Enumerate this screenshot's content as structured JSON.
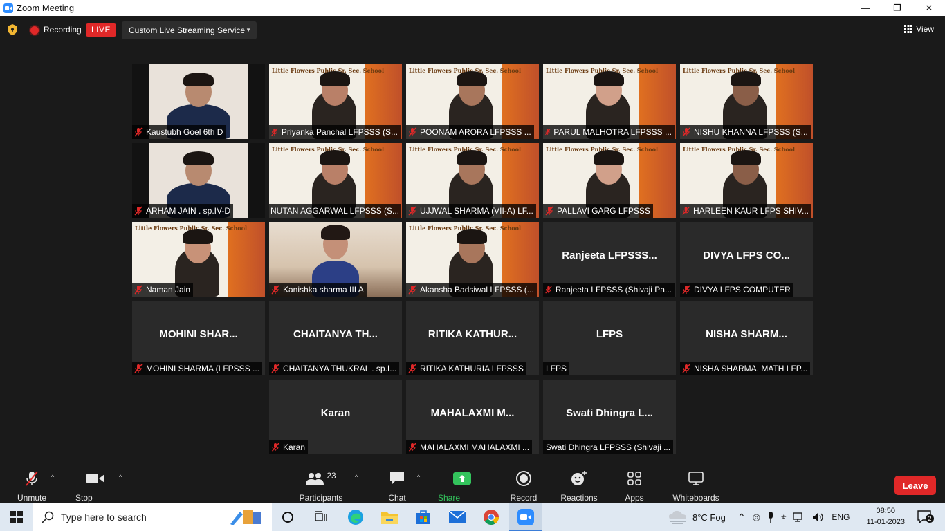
{
  "window": {
    "title": "Zoom Meeting",
    "minimize": "—",
    "maximize": "❐",
    "close": "✕"
  },
  "meeting_bar": {
    "recording_label": "Recording",
    "live_label": "LIVE",
    "stream_service": "Custom Live Streaming Service",
    "view_label": "View"
  },
  "tiles": [
    {
      "name": "Kaustubh Goel 6th D",
      "muted": true,
      "video": "boy-dark"
    },
    {
      "name": "Priyanka Panchal LFPSSS (S...",
      "muted": true,
      "video": "poster"
    },
    {
      "name": "POONAM ARORA  LFPSSS ...",
      "muted": true,
      "video": "poster"
    },
    {
      "name": "PARUL MALHOTRA LFPSSS ...",
      "muted": true,
      "video": "poster"
    },
    {
      "name": "NISHU KHANNA LFPSSS (S...",
      "muted": true,
      "video": "poster"
    },
    {
      "name": "ARHAM JAIN . sp.IV-D",
      "muted": true,
      "video": "boy-dark"
    },
    {
      "name": "NUTAN AGGARWAL LFPSSS (S...",
      "muted": false,
      "video": "poster",
      "active": true
    },
    {
      "name": "UJJWAL SHARMA (VII-A) LF...",
      "muted": true,
      "video": "poster"
    },
    {
      "name": "PALLAVI GARG LFPSSS",
      "muted": true,
      "video": "poster"
    },
    {
      "name": "HARLEEN KAUR LFPS SHIV...",
      "muted": true,
      "video": "poster"
    },
    {
      "name": "Naman Jain",
      "muted": true,
      "video": "poster"
    },
    {
      "name": "Kanishka sharma III A",
      "muted": true,
      "video": "room"
    },
    {
      "name": "Akansha Badsiwal LFPSSS (...",
      "muted": true,
      "video": "poster"
    },
    {
      "name": "Ranjeeta LFPSSS (Shivaji Pa...",
      "muted": true,
      "center": "Ranjeeta  LFPSSS..."
    },
    {
      "name": "DIVYA LFPS COMPUTER",
      "muted": true,
      "center": "DIVYA  LFPS  CO..."
    },
    {
      "name": "MOHINI SHARMA (LFPSSS ...",
      "muted": true,
      "center": "MOHINI  SHAR..."
    },
    {
      "name": "CHAITANYA THUKRAL . sp.I...",
      "muted": true,
      "center": "CHAITANYA  TH..."
    },
    {
      "name": "RITIKA KATHURIA LFPSSS",
      "muted": true,
      "center": "RITIKA  KATHUR..."
    },
    {
      "name": "LFPS",
      "muted": false,
      "center": "LFPS"
    },
    {
      "name": "NISHA SHARMA. MATH LFP...",
      "muted": true,
      "center": "NISHA  SHARM..."
    },
    {
      "name": "Karan",
      "muted": true,
      "center": "Karan"
    },
    {
      "name": "MAHALAXMI MAHALAXMI ...",
      "muted": true,
      "center": "MAHALAXMI  M..."
    },
    {
      "name": "Swati Dhingra LFPSSS (Shivaji ...",
      "muted": false,
      "center": "Swati  Dhingra  L..."
    }
  ],
  "poster_banner": "Little Flowers Public Sr. Sec. School",
  "toolbar": {
    "unmute": "Unmute",
    "stop_video": "Stop Video",
    "participants": "Participants",
    "participants_count": "23",
    "chat": "Chat",
    "share_screen": "Share Screen",
    "record": "Record",
    "reactions": "Reactions",
    "apps": "Apps",
    "whiteboards": "Whiteboards",
    "leave": "Leave"
  },
  "taskbar": {
    "search_placeholder": "Type here to search",
    "weather": "8°C  Fog",
    "language": "ENG",
    "time": "08:50",
    "date": "11-01-2023",
    "notifications": "2"
  },
  "colors": {
    "live": "#e02828",
    "share": "#33c35c",
    "active_speaker": "#b8e86b",
    "taskbar": "#dfe8f2"
  }
}
